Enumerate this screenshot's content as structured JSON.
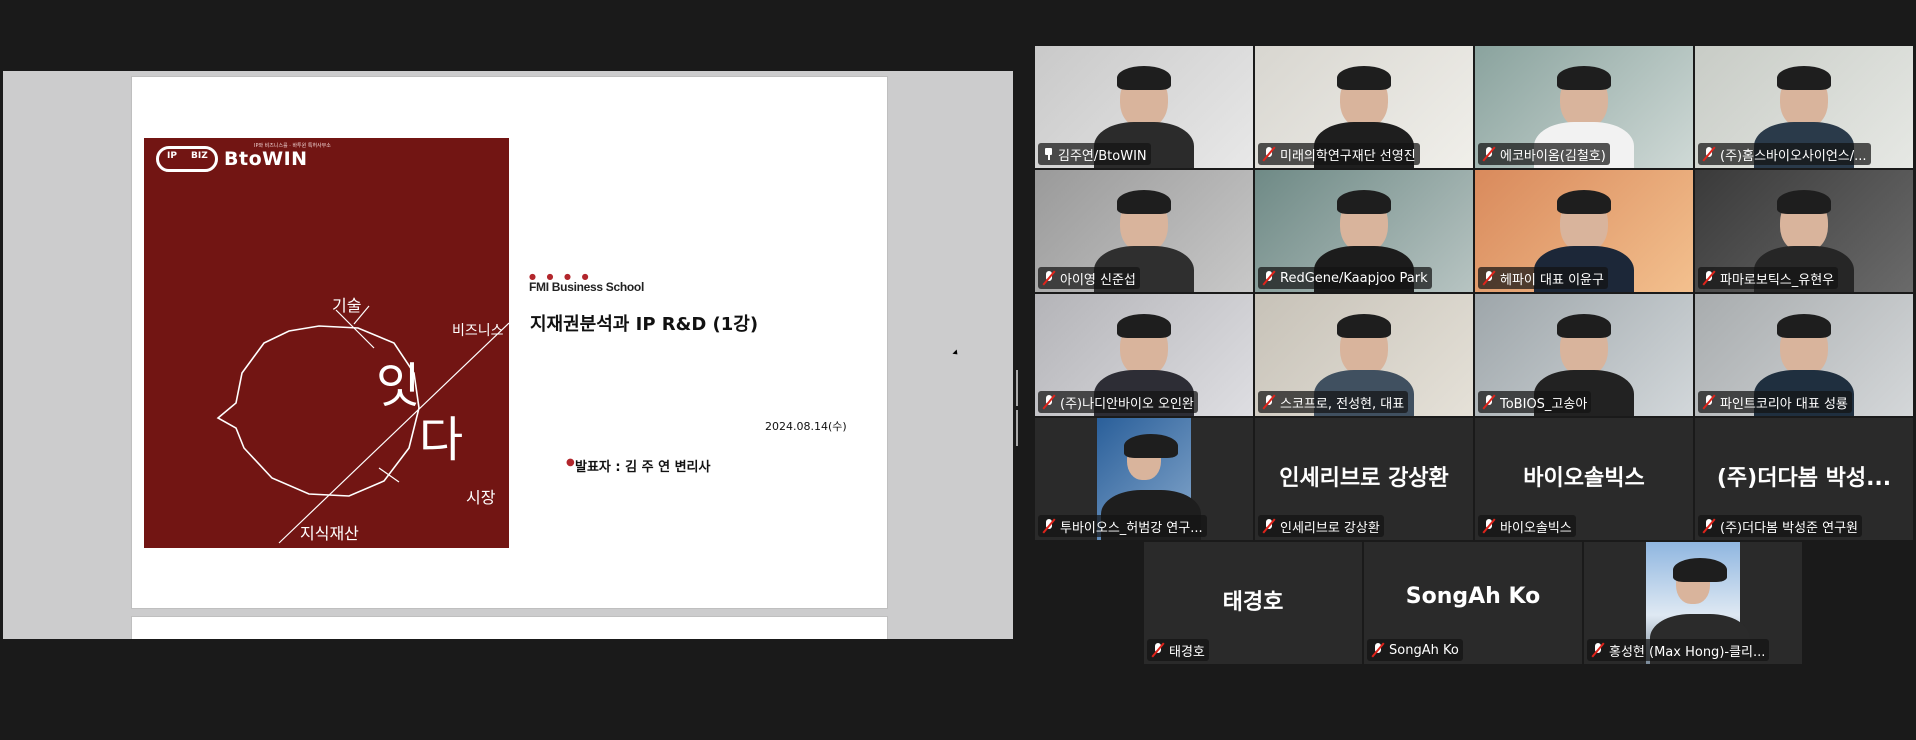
{
  "slide": {
    "logo_ip": "IP",
    "logo_biz": "BIZ",
    "logo_name": "BtoWIN",
    "logo_tagline": "IP와 비즈니스를 · 바투윈 특허사무소",
    "keyword_tech": "기술",
    "keyword_business": "비즈니스",
    "keyword_ip": "지식재산",
    "keyword_market": "시장",
    "center_word_1": "잇",
    "center_word_2": "다",
    "school_dots": "● ● ● ●",
    "school": "FMI Business School",
    "title": "지재권분석과 IP R&D (1강)",
    "date": "2024.08.14(수)",
    "presenter_bullet": "●",
    "presenter": "발표자 : 김 주 연 변리사"
  },
  "participants": [
    {
      "name": "김주연/BtoWIN",
      "pinned": true,
      "video": true,
      "active": true
    },
    {
      "name": "미래의학연구재단 선영진",
      "video": true
    },
    {
      "name": "에코바이옴(김철호)",
      "video": true
    },
    {
      "name": "(주)홈스바이오사이언스/...",
      "video": true
    },
    {
      "name": "아이영 신준섭",
      "video": true
    },
    {
      "name": "RedGene/Kaapjoo Park",
      "video": true
    },
    {
      "name": "헤파이 대표 이윤구",
      "video": true
    },
    {
      "name": "파마로보틱스_유현우",
      "video": true
    },
    {
      "name": "(주)나디안바이오 오인완",
      "video": true
    },
    {
      "name": "스코프로, 전성현, 대표",
      "video": true
    },
    {
      "name": "ToBIOS_고송아",
      "video": true
    },
    {
      "name": "파인트코리아 대표 성룡",
      "video": true
    },
    {
      "name": "투바이오스_허범강 연구...",
      "video": true
    },
    {
      "name": "인세리브로 강상환",
      "display": "인세리브로 강상환",
      "video": false
    },
    {
      "name": "바이오솔빅스",
      "display": "바이오솔빅스",
      "video": false
    },
    {
      "name": "(주)더다봄 박성준 연구원",
      "display": "(주)더다봄 박성...",
      "video": false
    },
    {
      "name": "태경호",
      "display": "태경호",
      "video": false
    },
    {
      "name": "SongAh Ko",
      "display": "SongAh Ko",
      "video": false
    },
    {
      "name": "홍성현 (Max Hong)-클리...",
      "video": true
    }
  ],
  "colors": {
    "active_speaker": "#22d27a",
    "mic_off": "#e0241b",
    "cover": "#721513"
  }
}
